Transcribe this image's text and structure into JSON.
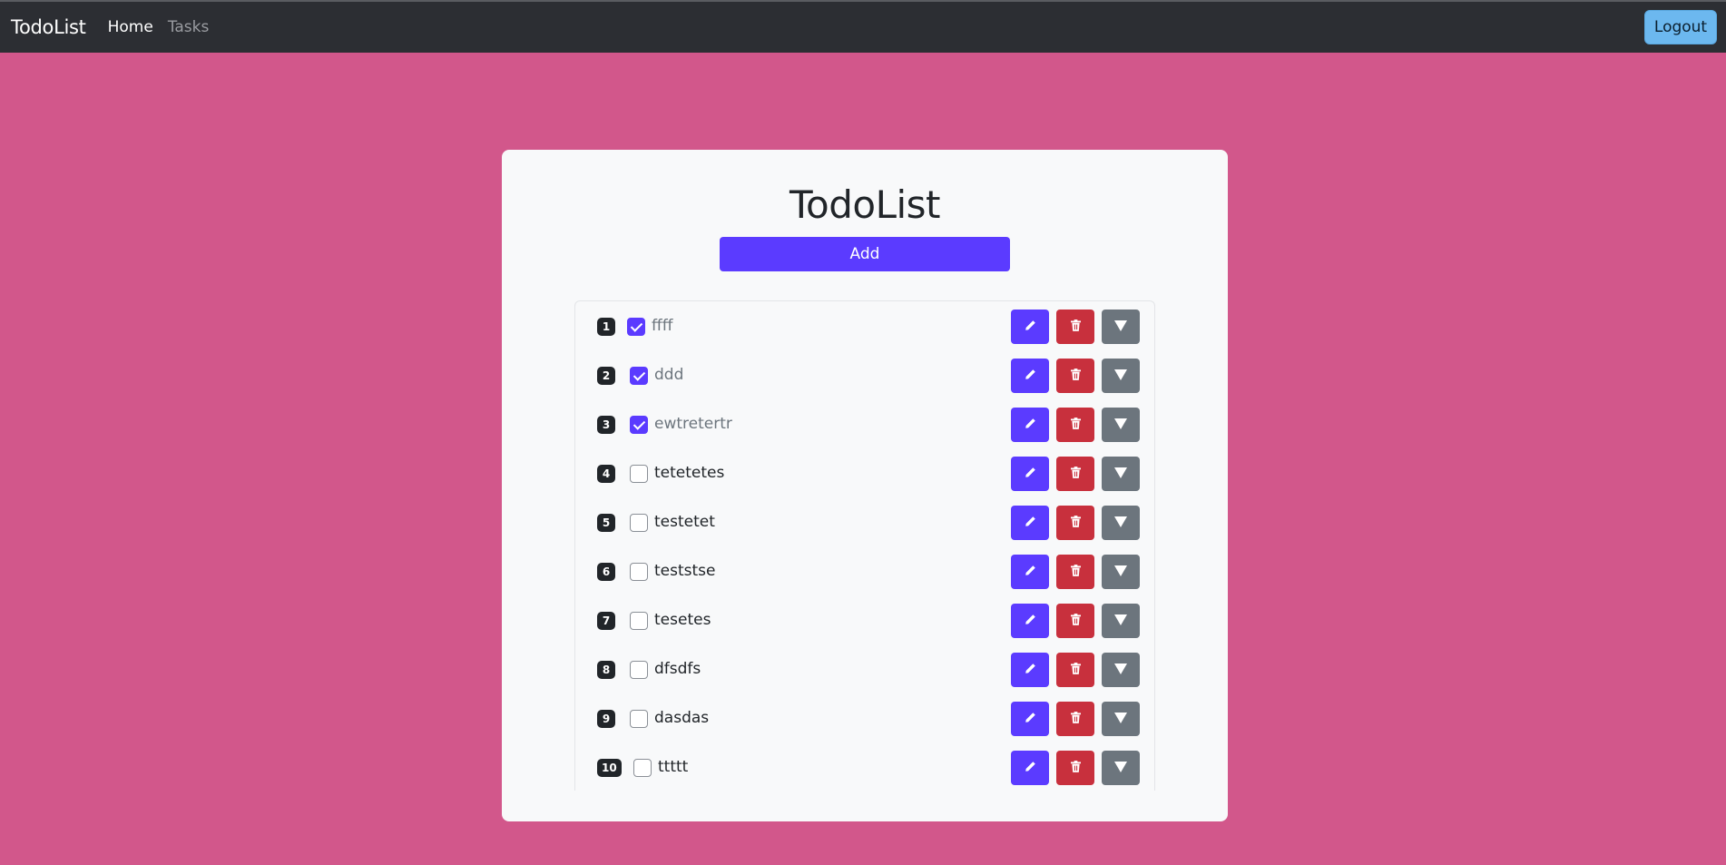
{
  "navbar": {
    "brand": "TodoList",
    "links": [
      {
        "label": "Home",
        "active": true
      },
      {
        "label": "Tasks",
        "active": false
      }
    ],
    "logout_label": "Logout"
  },
  "main": {
    "title": "TodoList",
    "add_label": "Add"
  },
  "tasks": [
    {
      "number": "1",
      "text": "ffff",
      "done": true
    },
    {
      "number": "2",
      "text": "ddd",
      "done": true
    },
    {
      "number": "3",
      "text": "ewtretertr",
      "done": true
    },
    {
      "number": "4",
      "text": "tetetetes",
      "done": false
    },
    {
      "number": "5",
      "text": "testetet",
      "done": false
    },
    {
      "number": "6",
      "text": "teststse",
      "done": false
    },
    {
      "number": "7",
      "text": "tesetes",
      "done": false
    },
    {
      "number": "8",
      "text": "dfsdfs",
      "done": false
    },
    {
      "number": "9",
      "text": "dasdas",
      "done": false
    },
    {
      "number": "10",
      "text": "ttttt",
      "done": false
    }
  ],
  "colors": {
    "background": "#d2578b",
    "navbar": "#2c2e33",
    "primary": "#5b3bff",
    "danger": "#c8303d",
    "secondary": "#6c757d",
    "logout": "#6cb8ef"
  },
  "icons": {
    "edit": "pencil-icon",
    "delete": "trash-icon",
    "expand": "triangle-down-icon"
  }
}
